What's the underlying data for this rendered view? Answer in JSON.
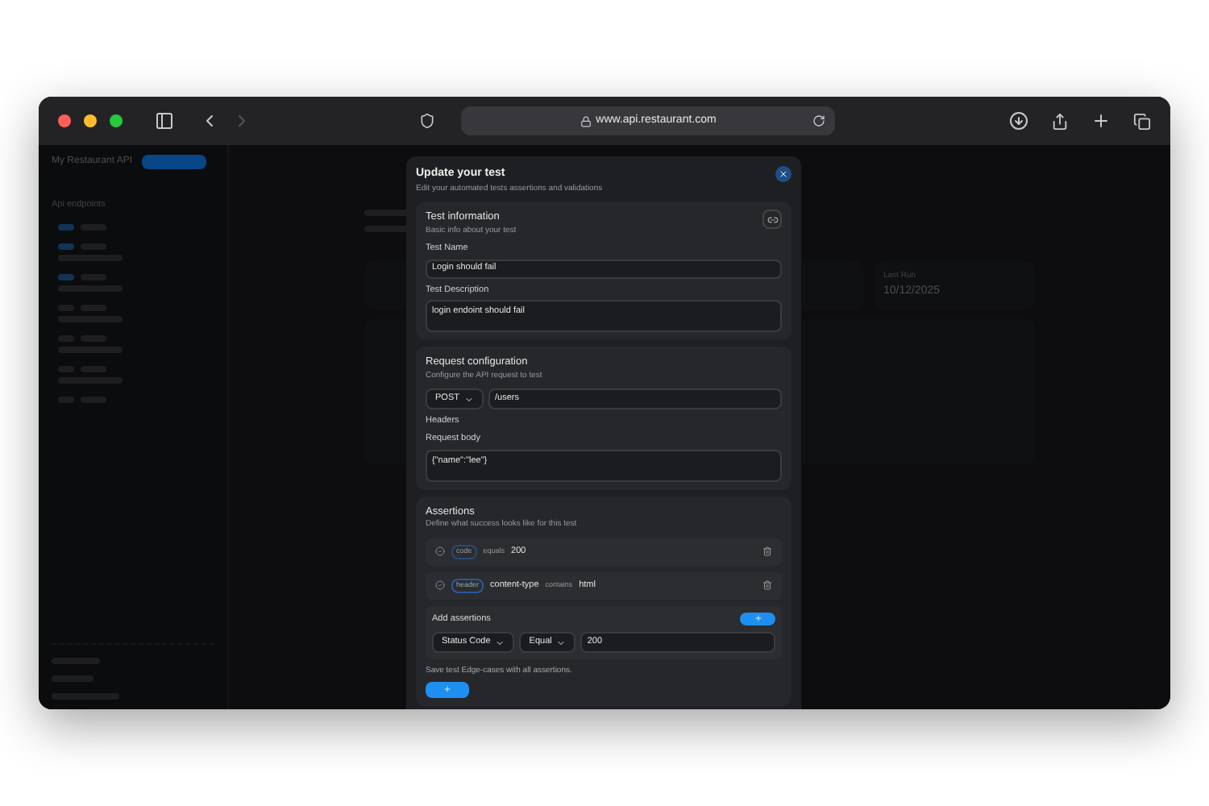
{
  "browser": {
    "url": "www.api.restaurant.com"
  },
  "app": {
    "title": "My Restaurant API",
    "sidebar_heading": "Api endpoints",
    "last_run_label": "Last Run",
    "last_run_value": "10/12/2025"
  },
  "modal": {
    "title": "Update your test",
    "subtitle": "Edit your automated tests assertions and validations"
  },
  "test_information": {
    "title": "Test information",
    "subtitle": "Basic info about your test",
    "fields": [
      {
        "kind": "input",
        "label": "Test Name",
        "value": "Login should fail"
      },
      {
        "kind": "textarea",
        "label": "Test Description",
        "value": "login endoint should fail"
      }
    ]
  },
  "request": {
    "title": "Request configuration",
    "subtitle": "Configure the API request to test",
    "method": "POST",
    "path": "/users",
    "headers_label": "Headers",
    "body_label": "Request body",
    "body": "{\"name\":\"lee\"}"
  },
  "assertions": {
    "title": "Assertions",
    "subtitle": "Define what success looks like for this test",
    "items": [
      {
        "type": "code",
        "operator": "equals",
        "value": "200"
      },
      {
        "type": "header",
        "field": "content-type",
        "operator": "contains",
        "value": "html"
      }
    ],
    "add": {
      "label": "Add assertions",
      "target": "Status Code",
      "comparison": "Equal",
      "value": "200"
    },
    "note": "Save test Edge-cases with all assertions."
  }
}
